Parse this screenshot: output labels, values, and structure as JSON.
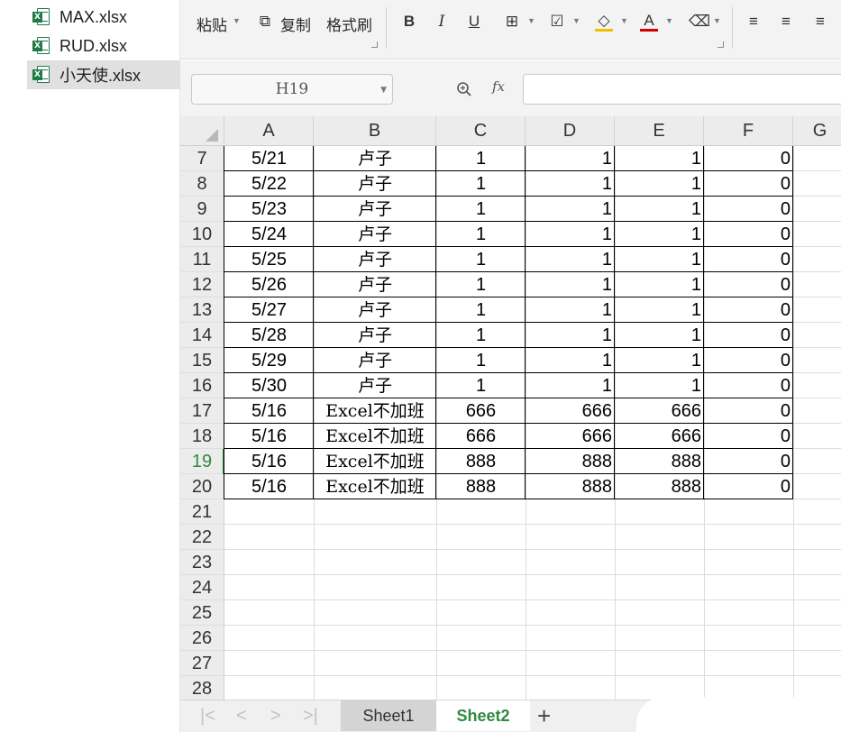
{
  "files": [
    {
      "name": "MAX.xlsx",
      "selected": false
    },
    {
      "name": "RUD.xlsx",
      "selected": false
    },
    {
      "name": "小天使.xlsx",
      "selected": true
    }
  ],
  "ribbon": {
    "paste_label": "粘贴",
    "copy_label": "复制",
    "format_painter_label": "格式刷"
  },
  "formula_bar": {
    "name_box": "H19",
    "fx_label": "fx",
    "formula_value": ""
  },
  "grid": {
    "columns": [
      "A",
      "B",
      "C",
      "D",
      "E",
      "F",
      "G"
    ],
    "rows": [
      {
        "num": "7",
        "cells": [
          "5/21",
          "卢子",
          "1",
          "1",
          "1",
          "0"
        ]
      },
      {
        "num": "8",
        "cells": [
          "5/22",
          "卢子",
          "1",
          "1",
          "1",
          "0"
        ]
      },
      {
        "num": "9",
        "cells": [
          "5/23",
          "卢子",
          "1",
          "1",
          "1",
          "0"
        ]
      },
      {
        "num": "10",
        "cells": [
          "5/24",
          "卢子",
          "1",
          "1",
          "1",
          "0"
        ]
      },
      {
        "num": "11",
        "cells": [
          "5/25",
          "卢子",
          "1",
          "1",
          "1",
          "0"
        ]
      },
      {
        "num": "12",
        "cells": [
          "5/26",
          "卢子",
          "1",
          "1",
          "1",
          "0"
        ]
      },
      {
        "num": "13",
        "cells": [
          "5/27",
          "卢子",
          "1",
          "1",
          "1",
          "0"
        ]
      },
      {
        "num": "14",
        "cells": [
          "5/28",
          "卢子",
          "1",
          "1",
          "1",
          "0"
        ]
      },
      {
        "num": "15",
        "cells": [
          "5/29",
          "卢子",
          "1",
          "1",
          "1",
          "0"
        ]
      },
      {
        "num": "16",
        "cells": [
          "5/30",
          "卢子",
          "1",
          "1",
          "1",
          "0"
        ]
      },
      {
        "num": "17",
        "cells": [
          "5/16",
          "Excel不加班",
          "666",
          "666",
          "666",
          "0"
        ]
      },
      {
        "num": "18",
        "cells": [
          "5/16",
          "Excel不加班",
          "666",
          "666",
          "666",
          "0"
        ]
      },
      {
        "num": "19",
        "cells": [
          "5/16",
          "Excel不加班",
          "888",
          "888",
          "888",
          "0"
        ]
      },
      {
        "num": "20",
        "cells": [
          "5/16",
          "Excel不加班",
          "888",
          "888",
          "888",
          "0"
        ]
      },
      {
        "num": "21",
        "cells": [
          "",
          "",
          "",
          "",
          "",
          ""
        ]
      },
      {
        "num": "22",
        "cells": [
          "",
          "",
          "",
          "",
          "",
          ""
        ]
      },
      {
        "num": "23",
        "cells": [
          "",
          "",
          "",
          "",
          "",
          ""
        ]
      },
      {
        "num": "24",
        "cells": [
          "",
          "",
          "",
          "",
          "",
          ""
        ]
      },
      {
        "num": "25",
        "cells": [
          "",
          "",
          "",
          "",
          "",
          ""
        ]
      },
      {
        "num": "26",
        "cells": [
          "",
          "",
          "",
          "",
          "",
          ""
        ]
      },
      {
        "num": "27",
        "cells": [
          "",
          "",
          "",
          "",
          "",
          ""
        ]
      },
      {
        "num": "28",
        "cells": [
          "",
          "",
          "",
          "",
          "",
          ""
        ]
      }
    ],
    "active_row": "19",
    "accent_color": "#2e8b42"
  },
  "sheets": [
    {
      "name": "Sheet1",
      "active": false
    },
    {
      "name": "Sheet2",
      "active": true
    }
  ],
  "add_sheet_label": "+"
}
